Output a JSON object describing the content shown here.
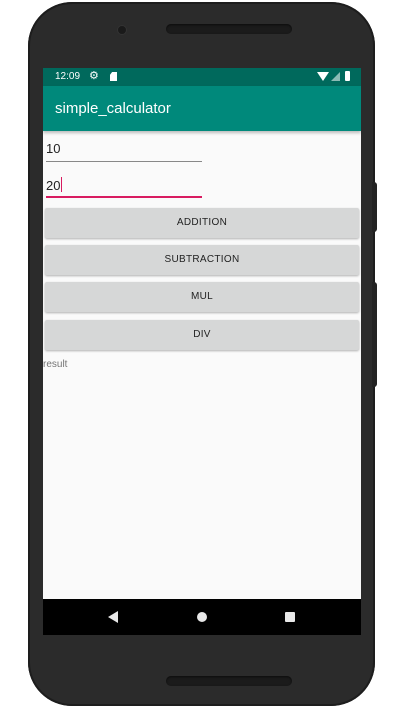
{
  "status_bar": {
    "time": "12:09",
    "icons": [
      "gear-icon",
      "sd-card-icon",
      "wifi-icon",
      "signal-icon",
      "battery-icon"
    ]
  },
  "app_bar": {
    "title": "simple_calculator",
    "color": "#00897b"
  },
  "inputs": {
    "first_value": "10",
    "second_value": "20",
    "focus_color": "#d81b60"
  },
  "buttons": {
    "addition": "ADDITION",
    "subtraction": "SUBTRACTION",
    "mul": "MUL",
    "div": "DIV"
  },
  "result_text": "result",
  "nav_bar": {
    "icons": [
      "back-icon",
      "home-icon",
      "recents-icon"
    ]
  }
}
